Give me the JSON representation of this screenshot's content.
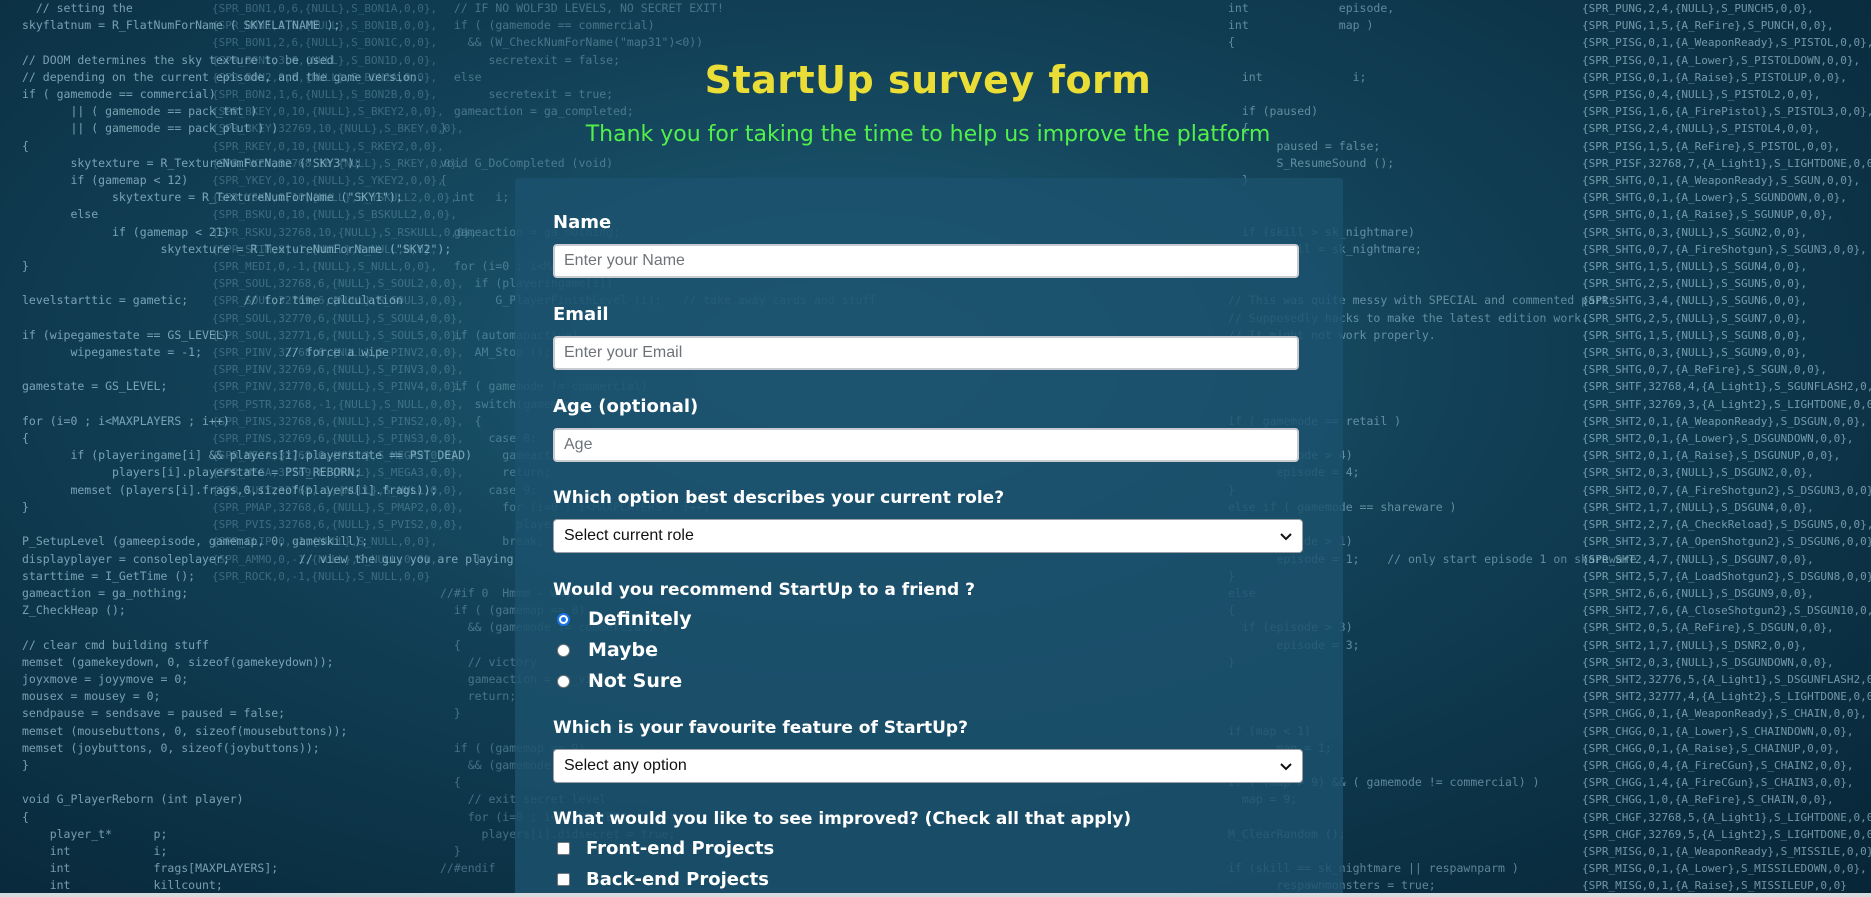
{
  "form": {
    "title": "StartUp survey form",
    "description": "Thank you for taking the time to help us improve the platform",
    "name": {
      "label": "Name",
      "placeholder": "Enter your Name"
    },
    "email": {
      "label": "Email",
      "placeholder": "Enter your Email"
    },
    "age": {
      "label": "Age (optional)",
      "placeholder": "Age"
    },
    "role": {
      "question": "Which option best describes your current role?",
      "selected": "Select current role"
    },
    "recommend": {
      "question": "Would you recommend StartUp to a friend ?",
      "options": [
        {
          "label": "Definitely",
          "checked": true
        },
        {
          "label": "Maybe",
          "checked": false
        },
        {
          "label": "Not Sure",
          "checked": false
        }
      ]
    },
    "feature": {
      "question": "Which is your favourite feature of StartUp?",
      "selected": "Select any option"
    },
    "improve": {
      "question": "What would you like to see improved? (Check all that apply)",
      "options": [
        {
          "label": "Front-end Projects",
          "checked": false
        },
        {
          "label": "Back-end Projects",
          "checked": false
        }
      ]
    }
  },
  "colors": {
    "title": "#e9dd36",
    "description": "#52f04a",
    "card": "#1c526e",
    "radio_accent": "#1a73e8"
  }
}
